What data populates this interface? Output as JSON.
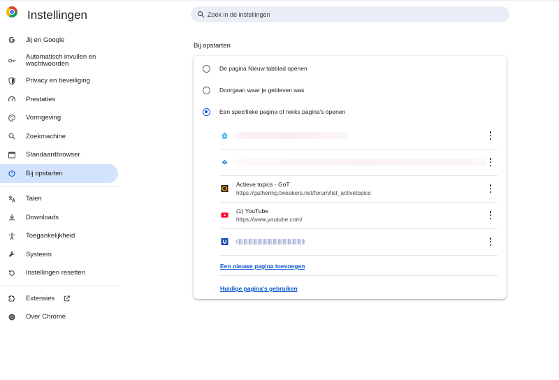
{
  "header": {
    "title": "Instellingen",
    "search_placeholder": "Zoek in de instellingen",
    "search_value": ""
  },
  "sidebar": {
    "items": [
      {
        "label": "Jij en Google",
        "icon": "google-g-icon"
      },
      {
        "label": "Automatisch invullen en wachtwoorden",
        "icon": "key-icon"
      },
      {
        "label": "Privacy en beveiliging",
        "icon": "shield-icon"
      },
      {
        "label": "Prestaties",
        "icon": "speedometer-icon"
      },
      {
        "label": "Vormgeving",
        "icon": "palette-icon"
      },
      {
        "label": "Zoekmachine",
        "icon": "search-icon"
      },
      {
        "label": "Standaardbrowser",
        "icon": "browser-window-icon"
      },
      {
        "label": "Bij opstarten",
        "icon": "power-icon",
        "active": true
      }
    ],
    "items2": [
      {
        "label": "Talen",
        "icon": "translate-icon"
      },
      {
        "label": "Downloads",
        "icon": "download-icon"
      },
      {
        "label": "Toegankelijkheid",
        "icon": "accessibility-icon"
      },
      {
        "label": "Systeem",
        "icon": "wrench-icon"
      },
      {
        "label": "Instellingen resetten",
        "icon": "reset-icon"
      }
    ],
    "items3": [
      {
        "label": "Extensies",
        "icon": "puzzle-icon"
      },
      {
        "label": "Over Chrome",
        "icon": "chrome-icon"
      }
    ]
  },
  "main": {
    "section_title": "Bij opstarten",
    "options": [
      {
        "label": "De pagina Nieuw tabblad openen",
        "checked": false
      },
      {
        "label": "Doorgaan waar je gebleven was",
        "checked": false
      },
      {
        "label": "Een specifieke pagina of reeks pagina's openen",
        "checked": true
      }
    ],
    "pages": [
      {
        "title": "",
        "url": "",
        "favicon": "home-favicon",
        "blurred": true
      },
      {
        "title": "",
        "url": "",
        "favicon": "arrow-favicon",
        "blurred": true
      },
      {
        "title": "Actieve topics - GoT",
        "url": "https://gathering.tweakers.net/forum/list_activetopics",
        "favicon": "tweakers-favicon"
      },
      {
        "title": "(1) YouTube",
        "url": "https://www.youtube.com/",
        "favicon": "youtube-favicon"
      },
      {
        "title": "",
        "url": "",
        "favicon": "u-favicon",
        "blurred": true
      }
    ],
    "add_page_link": "Een nieuwe pagina toevoegen",
    "use_current_link": "Huidige pagina's gebruiken"
  },
  "colors": {
    "accent": "#0b57d0",
    "active_nav_bg": "#d3e3fd",
    "search_bg": "#e9eef6"
  }
}
